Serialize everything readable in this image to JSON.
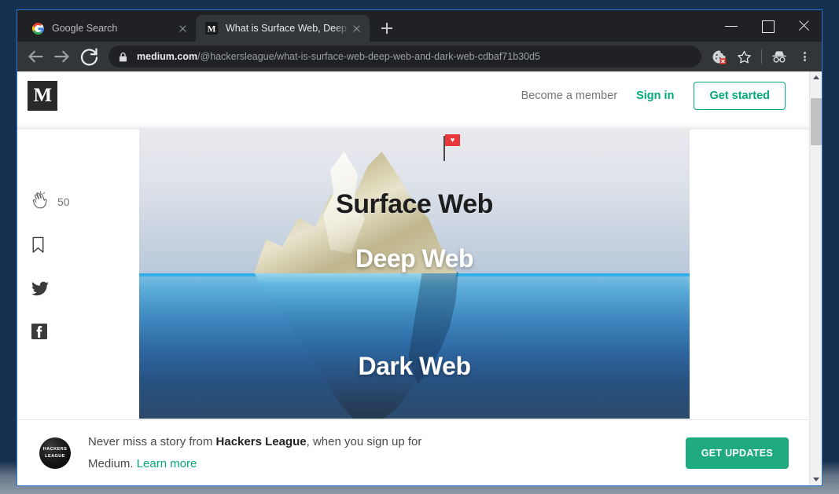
{
  "browser": {
    "tabs": [
      {
        "title": "Google Search",
        "favicon": "google-icon",
        "active": false
      },
      {
        "title": "What is Surface Web, Deep Web",
        "favicon": "medium-icon",
        "active": true
      }
    ],
    "new_tab_label": "+",
    "window_controls": {
      "minimize": "minimize",
      "maximize": "maximize",
      "close": "close"
    },
    "toolbar": {
      "back": "back-arrow",
      "forward": "forward-arrow",
      "reload": "reload-arrow",
      "lock": "lock-icon",
      "url_domain": "medium.com",
      "url_path": "/@hackersleague/what-is-surface-web-deep-web-and-dark-web-cdbaf71b30d5",
      "cookie_icon": "cookie-blocked-icon",
      "bookmark_icon": "star-icon",
      "incognito_icon": "incognito-icon",
      "menu_icon": "three-dot-menu-icon"
    }
  },
  "page": {
    "header": {
      "logo": "M",
      "become_member": "Become a member",
      "sign_in": "Sign in",
      "get_started": "Get started"
    },
    "rail": {
      "clap_icon": "clap-icon",
      "clap_count": "50",
      "bookmark_icon": "bookmark-icon",
      "twitter_icon": "twitter-icon",
      "facebook_icon": "facebook-icon"
    },
    "hero_image": {
      "alt": "iceberg-diagram",
      "flag_glyph": "♥",
      "labels": {
        "surface": "Surface Web",
        "deep": "Deep Web",
        "dark": "Dark Web"
      }
    },
    "banner": {
      "avatar_line1": "HACKERS",
      "avatar_line2": "LEAGUE",
      "text_before": "Never miss a story from ",
      "publication": "Hackers League",
      "text_middle": ", when you sign up for Medium. ",
      "learn_more": "Learn more",
      "cta": "GET UPDATES"
    }
  },
  "colors": {
    "medium_green": "#03a87c",
    "cta_green": "#1fab7f",
    "chrome_toolbar": "#323639",
    "chrome_tabstrip": "#202124",
    "window_border": "#2a7ad4"
  }
}
